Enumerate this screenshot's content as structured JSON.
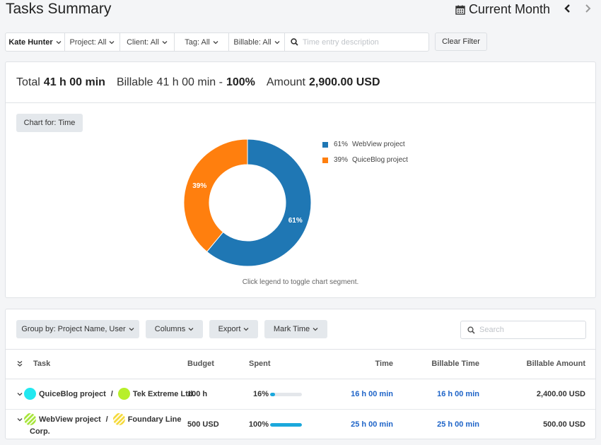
{
  "header": {
    "title": "Tasks Summary",
    "period_label": "Current Month",
    "calendar_icon": "calendar-icon",
    "prev_icon": "chevron-left-icon",
    "next_icon": "chevron-right-icon"
  },
  "filters": {
    "user": "Kate Hunter",
    "project": "Project: All",
    "client": "Client: All",
    "tag": "Tag: All",
    "billable": "Billable: All",
    "description_placeholder": "Time entry description",
    "description_value": "",
    "clear_label": "Clear Filter"
  },
  "summary": {
    "total_label": "Total",
    "total_value": "41 h 00 min",
    "billable_label": "Billable",
    "billable_value": "41 h 00 min -",
    "billable_pct": "100%",
    "amount_label": "Amount",
    "amount_value": "2,900.00 USD",
    "chart_for_label": "Chart for: Time",
    "chart_hint": "Click legend to toggle chart segment."
  },
  "chart_data": {
    "type": "pie",
    "donut": true,
    "title": "",
    "slices": [
      {
        "label": "WebView project",
        "value": 61,
        "pct_label": "61%",
        "color": "#1f77b4"
      },
      {
        "label": "QuiceBlog project",
        "value": 39,
        "pct_label": "39%",
        "color": "#ff7f0e"
      }
    ],
    "legend_position": "right",
    "start": "top",
    "direction": "clockwise"
  },
  "toolbar": {
    "group_by": "Group by: Project Name, User",
    "columns": "Columns",
    "export": "Export",
    "mark_time": "Mark Time",
    "search_placeholder": "Search",
    "search_value": ""
  },
  "table": {
    "headers": {
      "task": "Task",
      "budget": "Budget",
      "spent": "Spent",
      "time": "Time",
      "billable_time": "Billable Time",
      "billable_amount": "Billable Amount"
    },
    "rows": [
      {
        "project": "QuiceBlog project",
        "separator": "/",
        "client": "Tek Extreme Ltd.",
        "project_color": "#22e8f0",
        "client_color": "#b7ef2a",
        "project_pattern": "solid",
        "client_pattern": "solid",
        "budget": "100 h",
        "spent_pct": "16%",
        "spent_fraction": 0.16,
        "time": "16 h 00 min",
        "billable_time": "16 h 00 min",
        "billable_amount": "2,400.00 USD"
      },
      {
        "project": "WebView project",
        "separator": "/",
        "client": "Foundary Line",
        "client_line2": "Corp.",
        "project_color": "#a6e33a",
        "client_color": "#f5d93a",
        "project_pattern": "striped",
        "client_pattern": "striped",
        "budget": "500 USD",
        "spent_pct": "100%",
        "spent_fraction": 1.0,
        "time": "25 h 00 min",
        "billable_time": "25 h 00 min",
        "billable_amount": "500.00 USD"
      }
    ]
  }
}
